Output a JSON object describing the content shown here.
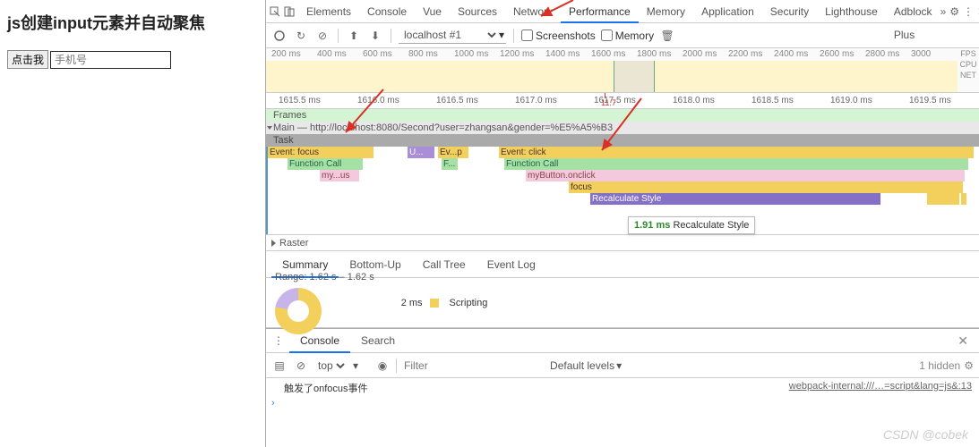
{
  "page": {
    "title": "js创建input元素并自动聚焦",
    "button": "点击我",
    "placeholder": "手机号"
  },
  "devtools": {
    "tabs": [
      "Elements",
      "Console",
      "Vue",
      "Sources",
      "Network",
      "Performance",
      "Memory",
      "Application",
      "Security",
      "Lighthouse",
      "Adblock Plus"
    ],
    "activeTab": "Performance",
    "toolbar": {
      "context": "localhost #1",
      "screenshots": "Screenshots",
      "memory": "Memory"
    },
    "overview": {
      "ticks": [
        "200 ms",
        "400 ms",
        "600 ms",
        "800 ms",
        "1000 ms",
        "1200 ms",
        "1400 ms",
        "1600 ms",
        "1800 ms",
        "2000 ms",
        "2200 ms",
        "2400 ms",
        "2600 ms",
        "2800 ms",
        "3000"
      ],
      "sideLabels": [
        "FPS",
        "CPU",
        "NET"
      ]
    },
    "ruler2": {
      "ticks": [
        "1615.5 ms",
        "1616.0 ms",
        "1616.5 ms",
        "1617.0 ms",
        "1617.5 ms",
        "1618.0 ms",
        "1618.5 ms",
        "1619.0 ms",
        "1619.5 ms"
      ],
      "redTick": "11.7 ms"
    },
    "tracks": {
      "frames": "Frames",
      "main": "Main — http://localhost:8080/Second?user=zhangsan&gender=%E5%A5%B3",
      "task": "Task",
      "flames": {
        "eventFocus": "Event: focus",
        "u": "U...",
        "evp": "Ev...p",
        "eventClick": "Event: click",
        "funcCall": "Function Call",
        "myus": "my...us",
        "f": "F...",
        "btnClick": "myButton.onclick",
        "focus": "focus",
        "recalc": "Recalculate Style"
      },
      "raster": "Raster"
    },
    "tooltip": {
      "ms": "1.91 ms",
      "label": "Recalculate Style"
    },
    "detailTabs": [
      "Summary",
      "Bottom-Up",
      "Call Tree",
      "Event Log"
    ],
    "summary": {
      "range": "Range: 1.62 s – 1.62 s",
      "scriptingMs": "2 ms",
      "scripting": "Scripting"
    },
    "drawer": {
      "tabs": [
        "Console",
        "Search"
      ],
      "activeTab": "Console"
    },
    "console": {
      "context": "top",
      "filter": "Filter",
      "levels": "Default levels",
      "hidden": "1 hidden",
      "rows": [
        {
          "msg": "触发了onfocus事件",
          "src": "webpack-internal:///…=script&lang=js&:13"
        }
      ]
    }
  },
  "watermark": "CSDN @cobek"
}
